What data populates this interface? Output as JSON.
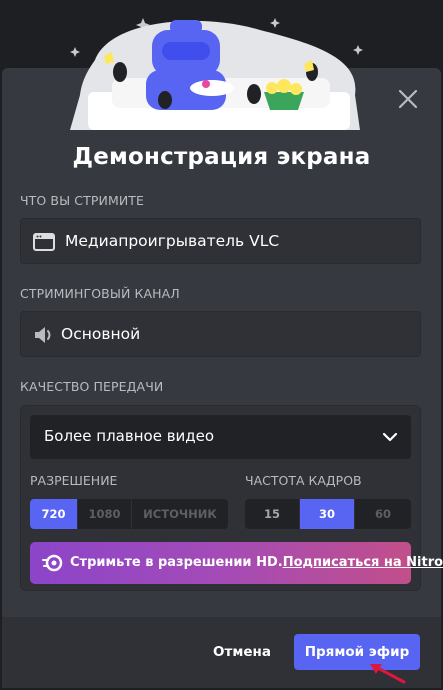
{
  "dialog": {
    "title": "Демонстрация экрана",
    "close_icon": "close-icon"
  },
  "source": {
    "label": "ЧТО ВЫ СТРИМИТЕ",
    "value": "Медиапроигрыватель VLC",
    "icon": "window-icon"
  },
  "channel": {
    "label": "СТРИМИНГОВЫЙ КАНАЛ",
    "value": "Основной",
    "icon": "speaker-icon"
  },
  "quality": {
    "label": "КАЧЕСТВО ПЕРЕДАЧИ",
    "preset": "Более плавное видео",
    "resolution": {
      "label": "РАЗРЕШЕНИЕ",
      "options": [
        "720",
        "1080",
        "ИСТОЧНИК"
      ],
      "selected": "720"
    },
    "framerate": {
      "label": "ЧАСТОТА КАДРОВ",
      "options": [
        "15",
        "30",
        "60"
      ],
      "selected": "30"
    },
    "nitro": {
      "text": "Стримьте в разрешении HD.",
      "link": "Подписаться на Nitro",
      "icon": "nitro-icon"
    }
  },
  "footer": {
    "cancel": "Отмена",
    "go_live": "Прямой эфир"
  },
  "colors": {
    "accent": "#5865f2",
    "modal_bg": "#36393f",
    "nitro_gradient_start": "#8c45c9",
    "nitro_gradient_end": "#c14f8a",
    "annotation_arrow": "#e0173d"
  }
}
